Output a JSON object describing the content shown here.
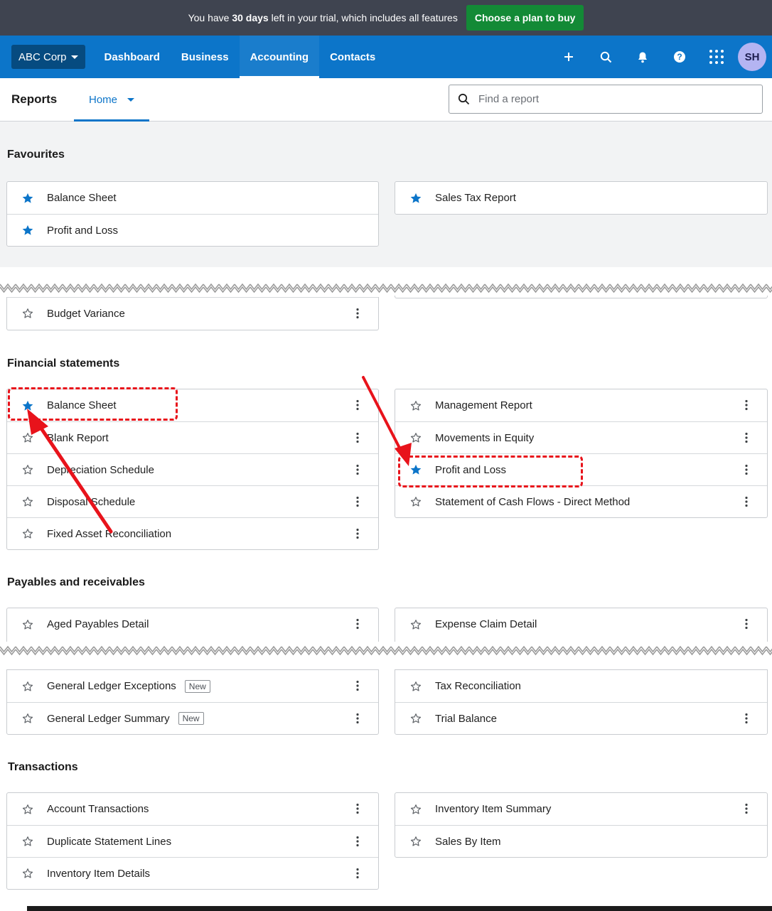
{
  "trial": {
    "prefix": "You have ",
    "days": "30 days",
    "suffix": " left in your trial, which includes all features",
    "button": "Choose a plan to buy"
  },
  "nav": {
    "org": "ABC Corp",
    "links": [
      "Dashboard",
      "Business",
      "Accounting",
      "Contacts"
    ],
    "active": "Accounting",
    "icons": [
      "plus-icon",
      "search-icon",
      "bell-icon",
      "help-icon",
      "apps-grid-icon"
    ],
    "avatar": "SH"
  },
  "subheader": {
    "title": "Reports",
    "home_tab": "Home",
    "search_placeholder": "Find a report"
  },
  "sections": {
    "favourites": {
      "title": "Favourites",
      "left": [
        "Balance Sheet",
        "Profit and Loss"
      ],
      "right": [
        "Sales Tax Report"
      ]
    },
    "truncated_row": "Budget Variance",
    "financial": {
      "title": "Financial statements",
      "left": [
        "Balance Sheet",
        "Blank Report",
        "Depreciation Schedule",
        "Disposal Schedule",
        "Fixed Asset Reconciliation"
      ],
      "right": [
        "Management Report",
        "Movements in Equity",
        "Profit and Loss",
        "Statement of Cash Flows - Direct Method"
      ]
    },
    "payables": {
      "title": "Payables and receivables",
      "left_top": "Aged Payables Detail",
      "right_top": "Expense Claim Detail",
      "left_bottom": [
        "General Ledger Exceptions",
        "General Ledger Summary"
      ],
      "right_bottom": [
        "Tax Reconciliation",
        "Trial Balance"
      ],
      "badge": "New"
    },
    "transactions": {
      "title": "Transactions",
      "left": [
        "Account Transactions",
        "Duplicate Statement Lines",
        "Inventory Item Details"
      ],
      "right": [
        "Inventory Item Summary",
        "Sales By Item"
      ]
    }
  },
  "colors": {
    "trial_bar": "#3f4450",
    "buy_button": "#138a36",
    "nav": "#0c75c9",
    "star_filled": "#0c75c9",
    "annotation": "#e8131b"
  }
}
